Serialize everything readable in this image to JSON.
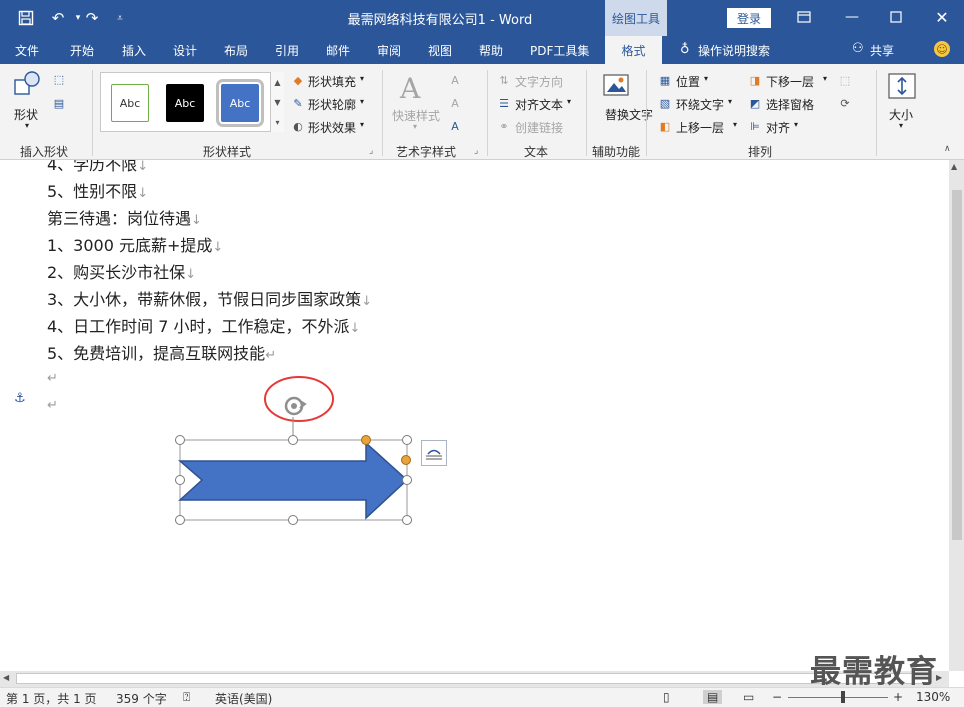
{
  "window": {
    "title": "最需网络科技有限公司1 - Word",
    "context_tab": "绘图工具",
    "login_label": "登录"
  },
  "menu": {
    "items": [
      "文件",
      "开始",
      "插入",
      "设计",
      "布局",
      "引用",
      "邮件",
      "审阅",
      "视图",
      "帮助",
      "PDF工具集"
    ],
    "active_tab": "格式",
    "tell_me": "操作说明搜索",
    "share": "共享"
  },
  "ribbon": {
    "insert_shapes": {
      "label": "插入形状",
      "shape_button": "形状"
    },
    "shape_styles": {
      "label": "形状样式",
      "gallery": [
        "Abc",
        "Abc",
        "Abc"
      ],
      "fill": "形状填充",
      "outline": "形状轮廓",
      "effects": "形状效果"
    },
    "wordart": {
      "label": "艺术字样式",
      "quick_styles": "快速样式"
    },
    "text": {
      "label": "文本",
      "direction": "文字方向",
      "align": "对齐文本",
      "link": "创建链接"
    },
    "accessibility": {
      "label": "辅助功能",
      "alt_text": "替换文字"
    },
    "arrange": {
      "label": "排列",
      "position": "位置",
      "wrap": "环绕文字",
      "forward": "上移一层",
      "backward": "下移一层",
      "selection_pane": "选择窗格",
      "align": "对齐"
    },
    "size": {
      "label": "大小"
    }
  },
  "document": {
    "lines": [
      "4、学历不限",
      "5、性别不限",
      "第三待遇：岗位待遇",
      "1、3000 元底薪+提成",
      "2、购买长沙市社保",
      "3、大小休，带薪休假，节假日同步国家政策",
      "4、日工作时间 7 小时，工作稳定，不外派",
      "5、免费培训，提高互联网技能"
    ]
  },
  "colors": {
    "accent": "#2b579a",
    "shape_fill": "#4472c4",
    "shape_outline": "#2f528f",
    "highlight_circle": "#e53935",
    "handle_orange": "#e8a33d"
  },
  "status": {
    "page": "第 1 页，共 1 页",
    "words": "359 个字",
    "language": "英语(美国)",
    "zoom": "130%"
  },
  "watermark": "最需教育"
}
